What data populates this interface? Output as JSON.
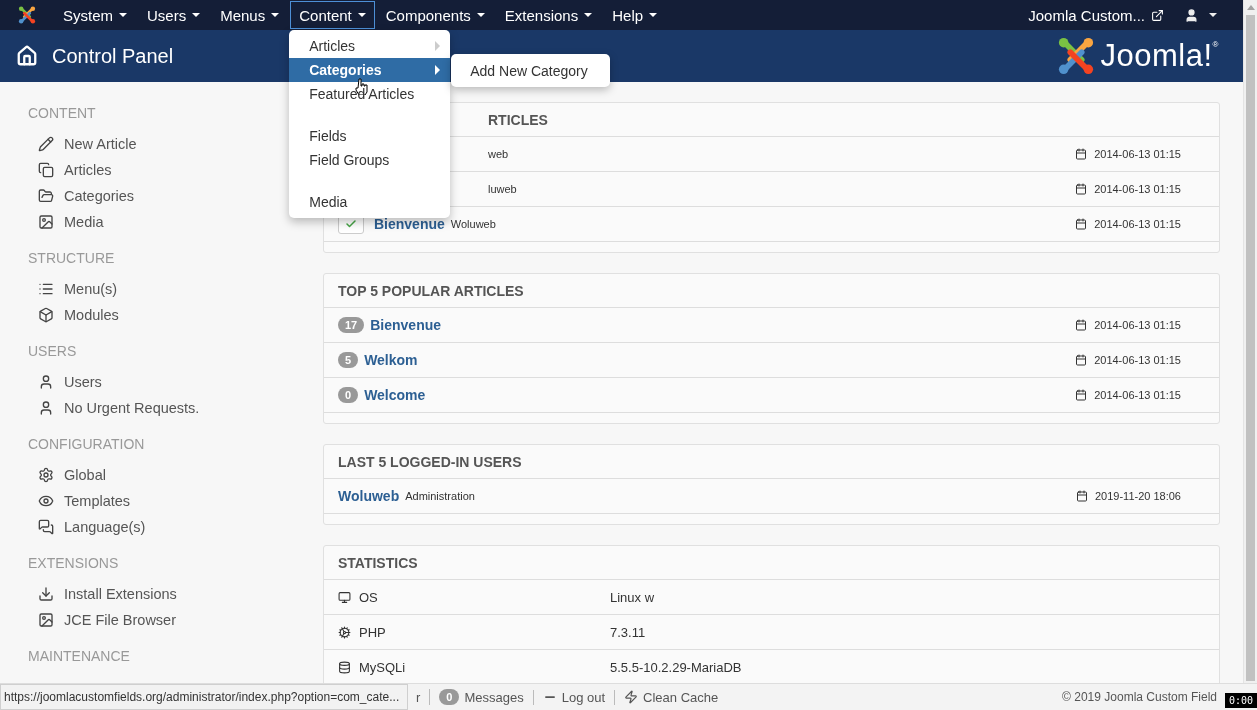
{
  "navbar": {
    "menus": [
      {
        "label": "System",
        "selected": false
      },
      {
        "label": "Users",
        "selected": false
      },
      {
        "label": "Menus",
        "selected": false
      },
      {
        "label": "Content",
        "selected": true
      },
      {
        "label": "Components",
        "selected": false
      },
      {
        "label": "Extensions",
        "selected": false
      },
      {
        "label": "Help",
        "selected": false
      }
    ],
    "site_link": "Joomla Custom..."
  },
  "content_menu": {
    "groups": [
      [
        {
          "label": "Articles",
          "submenu": true,
          "selected": false
        },
        {
          "label": "Categories",
          "submenu": true,
          "selected": true
        },
        {
          "label": "Featured Articles",
          "submenu": false,
          "selected": false
        }
      ],
      [
        {
          "label": "Fields",
          "submenu": false,
          "selected": false
        },
        {
          "label": "Field Groups",
          "submenu": false,
          "selected": false
        }
      ],
      [
        {
          "label": "Media",
          "submenu": false,
          "selected": false
        }
      ]
    ],
    "submenu": [
      "Add New Category"
    ]
  },
  "header": {
    "title": "Control Panel",
    "brand": "Joomla!$^{®}$"
  },
  "sidebar": [
    {
      "heading": "CONTENT",
      "items": [
        {
          "label": "New Article",
          "kind": "pencil"
        },
        {
          "label": "Articles",
          "kind": "copy"
        },
        {
          "label": "Categories",
          "kind": "folder"
        },
        {
          "label": "Media",
          "kind": "image"
        }
      ]
    },
    {
      "heading": "STRUCTURE",
      "items": [
        {
          "label": "Menu(s)",
          "kind": "list"
        },
        {
          "label": "Modules",
          "kind": "cube"
        }
      ]
    },
    {
      "heading": "USERS",
      "items": [
        {
          "label": "Users",
          "kind": "user"
        },
        {
          "label": "No Urgent Requests.",
          "kind": "user"
        }
      ]
    },
    {
      "heading": "CONFIGURATION",
      "items": [
        {
          "label": "Global",
          "kind": "gear"
        },
        {
          "label": "Templates",
          "kind": "eye"
        },
        {
          "label": "Language(s)",
          "kind": "chat"
        }
      ]
    },
    {
      "heading": "EXTENSIONS",
      "items": [
        {
          "label": "Install Extensions",
          "kind": "download"
        },
        {
          "label": "JCE File Browser",
          "kind": "image"
        }
      ]
    },
    {
      "heading": "MAINTENANCE"
    }
  ],
  "panels": [
    {
      "kind": "articles",
      "title": "RTICLES",
      "rows": [
        {
          "text": "web",
          "date": "2014-06-13 01:15"
        },
        {
          "text": "luweb",
          "date": "2014-06-13 01:15"
        },
        {
          "published": true,
          "title": "Bienvenue",
          "author": "Woluweb",
          "date": "2014-06-13 01:15"
        }
      ]
    },
    {
      "kind": "popular",
      "title": "TOP 5 POPULAR ARTICLES",
      "rows": [
        {
          "hits": "17",
          "title": "Bienvenue",
          "date": "2014-06-13 01:15"
        },
        {
          "hits": "5",
          "title": "Welkom",
          "date": "2014-06-13 01:15"
        },
        {
          "hits": "0",
          "title": "Welcome",
          "date": "2014-06-13 01:15"
        }
      ]
    },
    {
      "kind": "users",
      "title": "LAST 5 LOGGED-IN USERS",
      "rows": [
        {
          "title": "Woluweb",
          "author": "Administration",
          "date": "2019-11-20 18:06"
        }
      ]
    },
    {
      "kind": "stats",
      "title": "STATISTICS",
      "rows": [
        {
          "kind": "os",
          "label": "OS",
          "value": "Linux w"
        },
        {
          "kind": "php",
          "label": "PHP",
          "value": "7.3.11"
        },
        {
          "kind": "db",
          "label": "MySQLi",
          "value": "5.5.5-10.2.29-MariaDB"
        }
      ]
    }
  ],
  "footer": {
    "cut_item": "r",
    "messages_count": "0",
    "messages": "Messages",
    "logout": "Log out",
    "clean_cache": "Clean Cache",
    "copyright": "© 2019 Joomla Custom Field"
  },
  "status_url": "https://joomlacustomfields.org/administrator/index.php?option=com_cate...",
  "timer": "0:00"
}
